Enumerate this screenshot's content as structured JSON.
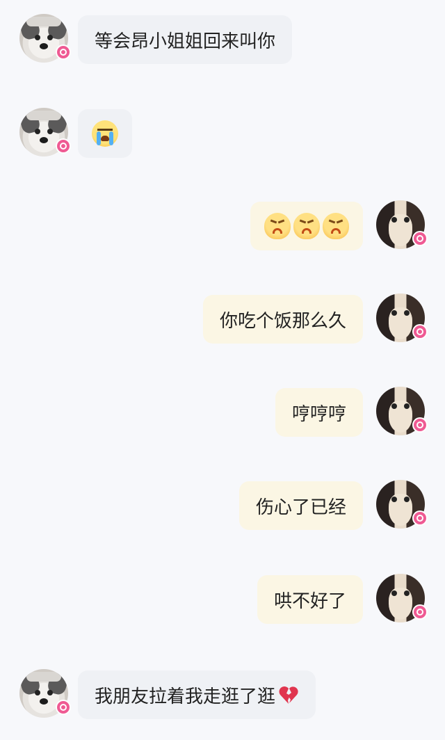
{
  "messages": [
    {
      "side": "left",
      "avatar": "dog-avatar",
      "text": "等会昂小姐姐回来叫你"
    },
    {
      "side": "left",
      "avatar": "dog-avatar",
      "emoji": "crying-face-icon"
    },
    {
      "side": "right",
      "avatar": "cat-avatar",
      "emoji": "angry-face-icon x3"
    },
    {
      "side": "right",
      "avatar": "cat-avatar",
      "text": "你吃个饭那么久"
    },
    {
      "side": "right",
      "avatar": "cat-avatar",
      "text": "哼哼哼"
    },
    {
      "side": "right",
      "avatar": "cat-avatar",
      "text": "伤心了已经"
    },
    {
      "side": "right",
      "avatar": "cat-avatar",
      "text": "哄不好了"
    },
    {
      "side": "left",
      "avatar": "dog-avatar",
      "text": "我朋友拉着我走逛了逛",
      "trailing_emoji": "broken-heart-icon"
    }
  ],
  "colors": {
    "background": "#f7f8fb",
    "left_bubble": "#eff1f5",
    "right_bubble": "#fbf6e4",
    "badge": "#ef5a93"
  }
}
